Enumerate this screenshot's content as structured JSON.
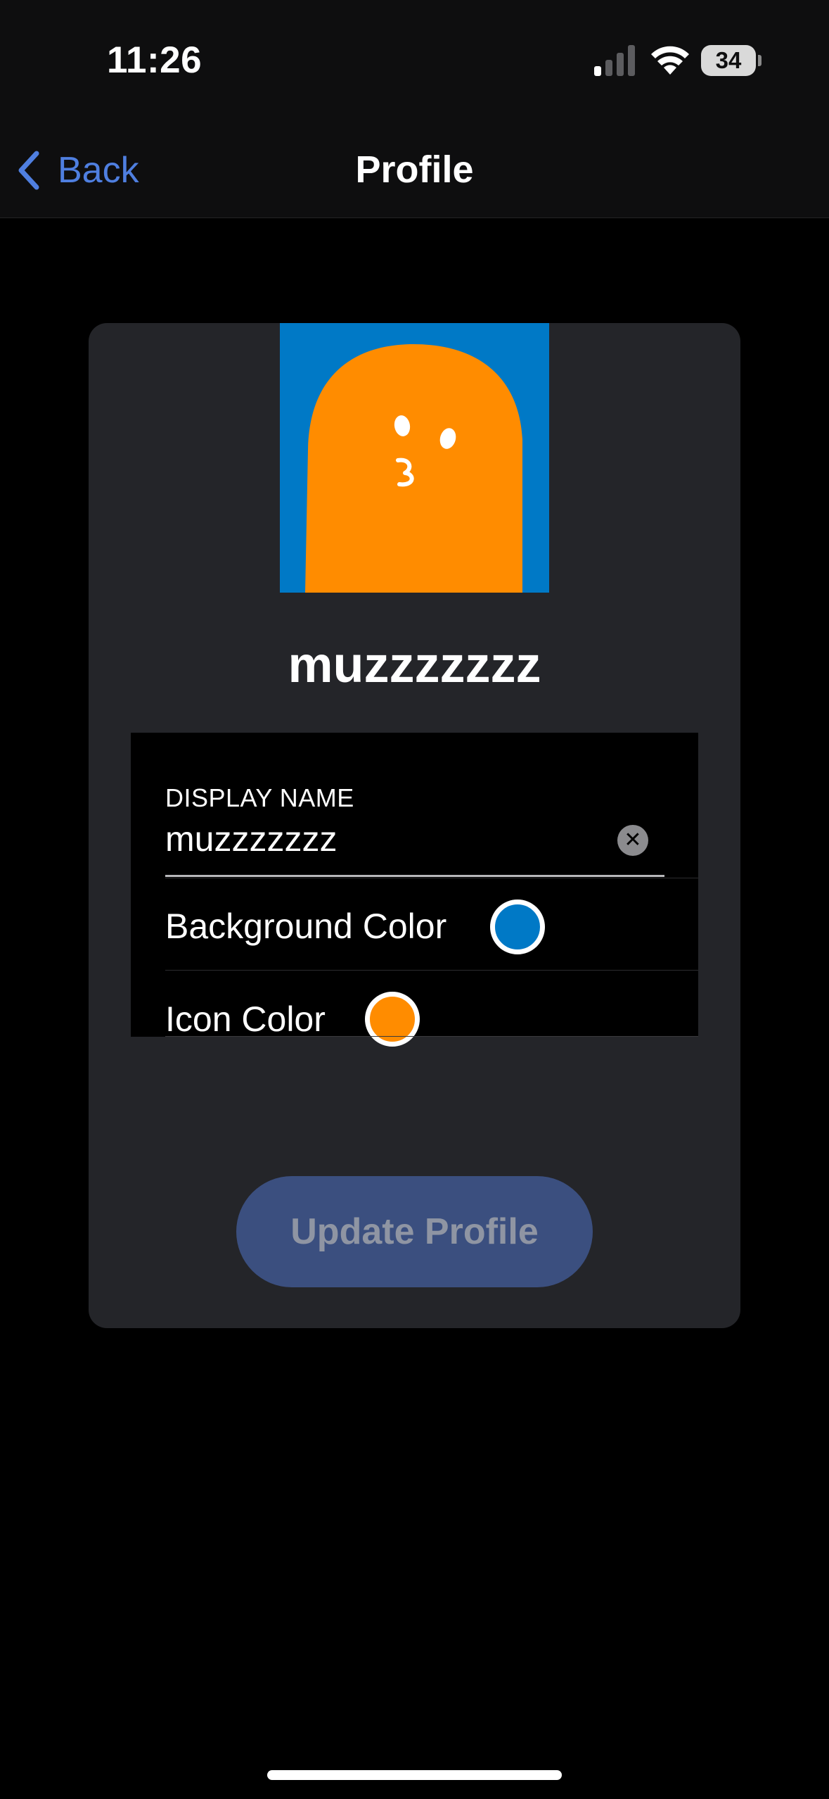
{
  "status_bar": {
    "time": "11:26",
    "battery_level": "34",
    "icons": [
      "signal-icon",
      "wifi-icon",
      "battery-icon"
    ]
  },
  "nav": {
    "back_label": "Back",
    "title": "Profile",
    "back_icon": "chevron-left-icon"
  },
  "profile": {
    "username": "muzzzzzzz",
    "avatar_icon": "ghost-avatar-icon"
  },
  "form": {
    "display_name_label": "DISPLAY NAME",
    "display_name_value": "muzzzzzzz",
    "clear_icon": "clear-icon",
    "background_color_label": "Background Color",
    "background_color_value": "#0079c6",
    "icon_color_label": "Icon Color",
    "icon_color_value": "#ff8c00"
  },
  "actions": {
    "update_label": "Update Profile"
  },
  "colors": {
    "accent": "#4f7fe0",
    "button_bg": "#3b4f7f",
    "card_bg": "#242529"
  }
}
